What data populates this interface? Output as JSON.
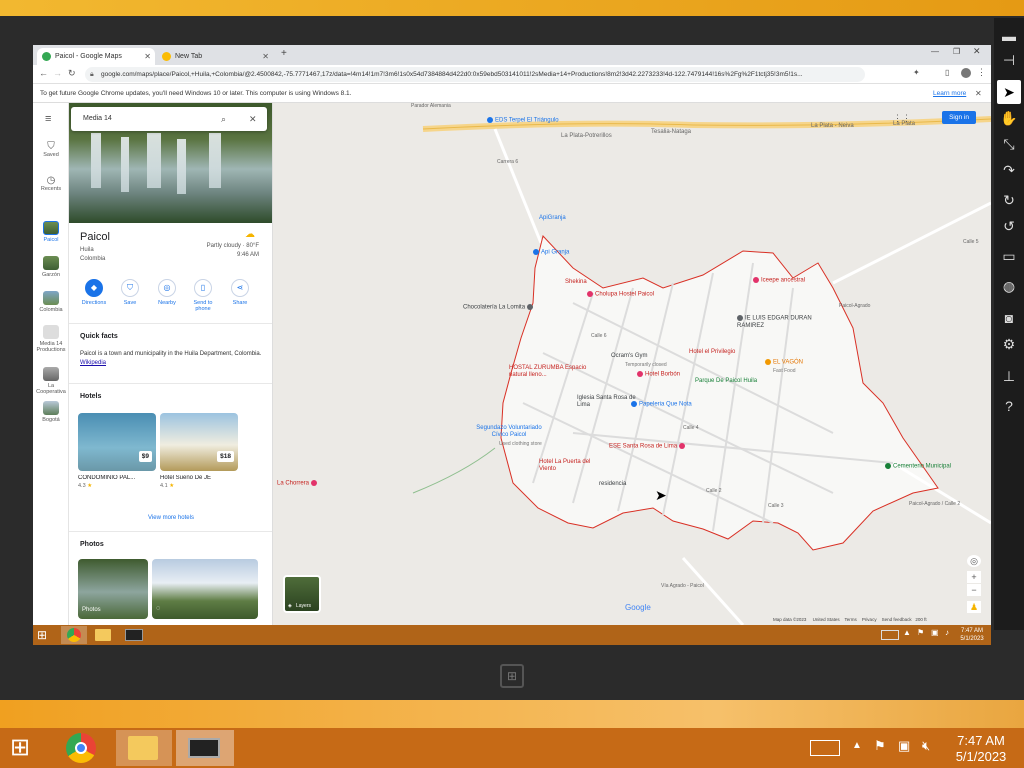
{
  "browser": {
    "tabs": [
      {
        "label": "Paicol - Google Maps",
        "active": true
      },
      {
        "label": "New Tab",
        "active": false
      }
    ],
    "url": "google.com/maps/place/Paicol,+Huila,+Colombia/@2.4500842,-75.7771467,17z/data=!4m14!1m7!3m6!1s0x54d7384884d422d0:0x59ebd503141011!2sMedia+14+Productions!8m2!3d42.2273233!4d-122.7479144!16s%2Fg%2F1tctj35!3m5!1s...",
    "infobar_text": "To get future Google Chrome updates, you'll need Windows 10 or later. This computer is using Windows 8.1.",
    "infobar_link": "Learn more"
  },
  "maps": {
    "search_value": "Media 14",
    "rail": [
      {
        "label": "Saved"
      },
      {
        "label": "Recents"
      },
      {
        "label": "Paicol"
      },
      {
        "label": "Garzón"
      },
      {
        "label": "Colombia"
      },
      {
        "label": "Media 14 Productions"
      },
      {
        "label": "La Cooperativa"
      },
      {
        "label": "Bogotá"
      }
    ],
    "place": {
      "name": "Paicol",
      "region": "Huila",
      "country": "Colombia",
      "weather": "Partly cloudy · 80°F",
      "time": "9:46 AM"
    },
    "actions": [
      "Directions",
      "Save",
      "Nearby",
      "Send to phone",
      "Share"
    ],
    "quick_facts_title": "Quick facts",
    "quick_facts_text": "Paicol is a town and municipality in the Huila Department, Colombia.",
    "quick_facts_link": "Wikipedia",
    "hotels_title": "Hotels",
    "hotels": [
      {
        "name": "CONDOMINIO PAL...",
        "rating": "4.3",
        "price": "$9"
      },
      {
        "name": "Hotel Sueño De JE",
        "rating": "4.1",
        "price": "$18"
      }
    ],
    "view_more_hotels": "View more hotels",
    "photos_title": "Photos",
    "photos_label": "Photos",
    "signin": "Sign in",
    "layers": "Layers",
    "footer": [
      "Map data ©2023",
      "United States",
      "Terms",
      "Privacy",
      "Send feedback",
      "200 ft"
    ]
  },
  "map_labels": {
    "roads": [
      "La Plata-Potrerillos",
      "Tesalia-Nataga",
      "La Plata - Neiva",
      "La Plata",
      "Parador Alemania",
      "Calle 5",
      "Paicol-Agrado",
      "Paicol-Agrado / Calle 2",
      "Vía Agrado - Paicol",
      "Carrera 6",
      "Calle 4",
      "Calle 3",
      "Calle 6",
      "Calle 2"
    ],
    "pois": [
      {
        "name": "EDS Terpel El Triángulo",
        "kind": "fuel"
      },
      {
        "name": "ApiGranja",
        "kind": "shop"
      },
      {
        "name": "Api Granja",
        "kind": "shop"
      },
      {
        "name": "Shekina",
        "kind": "hotel"
      },
      {
        "name": "Cholupa Hostel Paicol",
        "kind": "hotel"
      },
      {
        "name": "Iceepe ancestral",
        "kind": "hotel"
      },
      {
        "name": "IE LUIS EDGAR DURAN RAMIREZ",
        "kind": "school"
      },
      {
        "name": "Chocolatería La Lomita",
        "kind": "place"
      },
      {
        "name": "HOSTAL ZURUMBA Espacio natural lleno...",
        "kind": "hotel"
      },
      {
        "name": "Ocram's Gym",
        "kind": "place"
      },
      {
        "name": "Temporarily closed",
        "kind": "note"
      },
      {
        "name": "Hotel Borbón",
        "kind": "hotel"
      },
      {
        "name": "Hotel el Privilegio",
        "kind": "hotel"
      },
      {
        "name": "EL VAGÓN",
        "kind": "food"
      },
      {
        "name": "Fast Food",
        "kind": "note"
      },
      {
        "name": "Parque De Paicol Huila",
        "kind": "park"
      },
      {
        "name": "Iglesia Santa Rosa de Lima",
        "kind": "place"
      },
      {
        "name": "Papeleria Que Nota",
        "kind": "shop"
      },
      {
        "name": "Segundazo Voluntariado Cívico Paicol",
        "kind": "shop"
      },
      {
        "name": "Used clothing store",
        "kind": "note"
      },
      {
        "name": "ESE Santa Rosa de Lima",
        "kind": "hospital"
      },
      {
        "name": "Hotel La Puerta del Viento",
        "kind": "hotel"
      },
      {
        "name": "residencia",
        "kind": "place"
      },
      {
        "name": "Cementerio Municipal",
        "kind": "park"
      },
      {
        "name": "La Chorrera",
        "kind": "hotel"
      }
    ],
    "google": "Google"
  },
  "system": {
    "time": "7:47 AM",
    "date": "5/1/2023",
    "inner_time": "7:47 AM",
    "inner_date": "5/1/2023"
  },
  "colors": {
    "accent": "#1a73e8",
    "boundary": "#d93025",
    "hotel_pin": "#e2336a",
    "park_pin": "#188038"
  }
}
